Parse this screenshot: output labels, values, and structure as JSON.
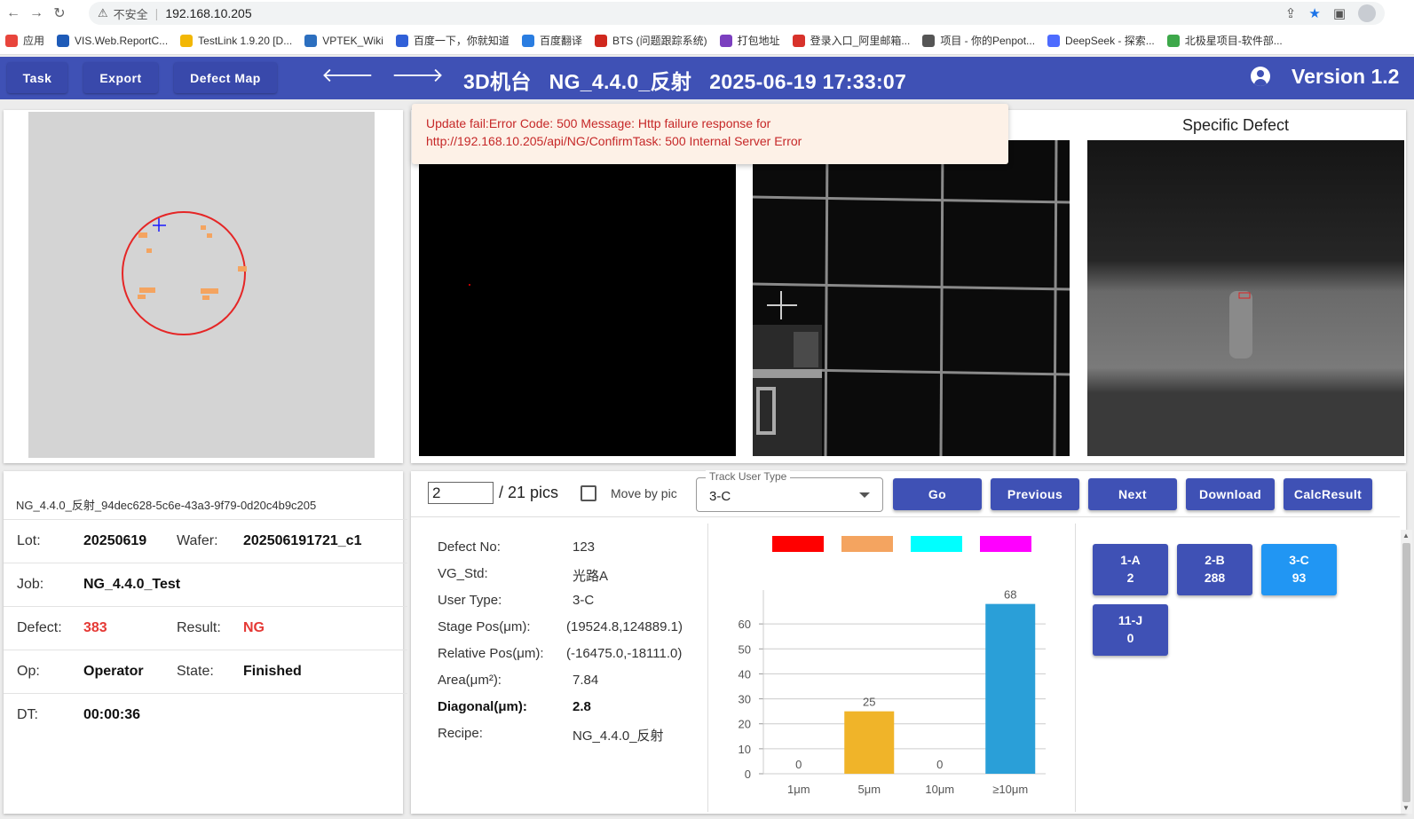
{
  "browser": {
    "security_label": "不安全",
    "url": "192.168.10.205",
    "bookmarks": [
      {
        "label": "应用",
        "color": "#e8453c"
      },
      {
        "label": "VIS.Web.ReportC...",
        "color": "#1e5bb8"
      },
      {
        "label": "TestLink 1.9.20 [D...",
        "color": "#f2b705"
      },
      {
        "label": "VPTEK_Wiki",
        "color": "#2c6fbf"
      },
      {
        "label": "百度一下，你就知道",
        "color": "#3060d8"
      },
      {
        "label": "百度翻译",
        "color": "#2a7de1"
      },
      {
        "label": "BTS (问题跟踪系统)",
        "color": "#d0281e"
      },
      {
        "label": "打包地址",
        "color": "#7b3fbf"
      },
      {
        "label": "登录入口_阿里邮箱...",
        "color": "#d8322b"
      },
      {
        "label": "项目 - 你的Penpot...",
        "color": "#555555"
      },
      {
        "label": "DeepSeek - 探索...",
        "color": "#4d6bfe"
      },
      {
        "label": "北极星项目-软件部...",
        "color": "#3da84a"
      }
    ]
  },
  "header": {
    "task_label": "Task",
    "export_label": "Export",
    "defect_map_label": "Defect Map",
    "title": "3D机台   NG_4.4.0_反射   2025-06-19 17:33:07",
    "version": "Version 1.2"
  },
  "error": {
    "line1": "Update fail:Error Code: 500 Message: Http failure response for",
    "line2": "http://192.168.10.205/api/NG/ConfirmTask: 500 Internal Server Error"
  },
  "images": {
    "specific_title": "Specific Defect"
  },
  "info": {
    "id": "NG_4.4.0_反射_94dec628-5c6e-43a3-9f79-0d20c4b9c205",
    "lot_label": "Lot:",
    "lot": "20250619",
    "wafer_label": "Wafer:",
    "wafer": "202506191721_c1",
    "job_label": "Job:",
    "job": "NG_4.4.0_Test",
    "defect_label": "Defect:",
    "defect": "383",
    "result_label": "Result:",
    "result": "NG",
    "op_label": "Op:",
    "op": "Operator",
    "state_label": "State:",
    "state": "Finished",
    "dt_label": "DT:",
    "dt": "00:00:36"
  },
  "controls": {
    "pic_index": "2",
    "pics_total": "/ 21 pics",
    "move_by_pic": "Move by pic",
    "track_legend": "Track User Type",
    "track_value": "3-C",
    "go": "Go",
    "previous": "Previous",
    "next": "Next",
    "download": "Download",
    "calc": "CalcResult"
  },
  "defect": {
    "no_label": "Defect No:",
    "no": "123",
    "vg_label": "VG_Std:",
    "vg": "光路A",
    "type_label": "User Type:",
    "type": "3-C",
    "stage_label": "Stage Pos(μm):",
    "stage": "(19524.8,124889.1)",
    "rel_label": "Relative Pos(μm):",
    "rel": "(-16475.0,-18111.0)",
    "area_label": "Area(μm²):",
    "area": "7.84",
    "diag_label": "Diagonal(μm):",
    "diag": "2.8",
    "recipe_label": "Recipe:",
    "recipe": "NG_4.4.0_反射"
  },
  "chart_data": {
    "type": "bar",
    "categories": [
      "1μm",
      "5μm",
      "10μm",
      "≥10μm"
    ],
    "values": [
      0,
      25,
      0,
      68
    ],
    "bar_colors": [
      "#ff0000",
      "#f0b429",
      "#00ffff",
      "#2a9fd8"
    ],
    "legend_colors": [
      "#ff0000",
      "#f4a460",
      "#00ffff",
      "#ff00ff"
    ],
    "y_ticks": [
      0,
      10,
      20,
      30,
      40,
      50,
      60
    ],
    "ylim": [
      0,
      70
    ],
    "grid": true,
    "legend_position": "top"
  },
  "tiles": [
    {
      "name": "1-A",
      "count": "2",
      "active": false
    },
    {
      "name": "2-B",
      "count": "288",
      "active": false
    },
    {
      "name": "3-C",
      "count": "93",
      "active": true
    },
    {
      "name": "11-J",
      "count": "0",
      "active": false
    }
  ]
}
